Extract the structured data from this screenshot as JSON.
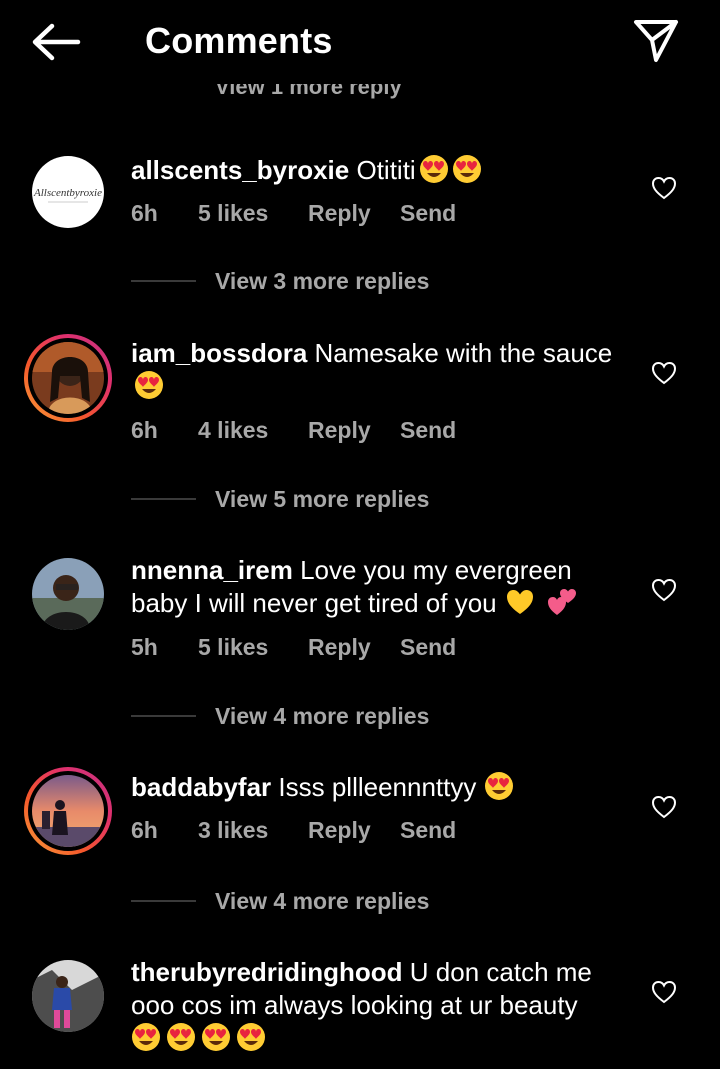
{
  "header": {
    "title": "Comments"
  },
  "partial_view_replies": "View 1 more reply",
  "comments": [
    {
      "username": "allscents_byroxie",
      "text": "Otititi",
      "emoji": [
        "heart-eyes",
        "heart-eyes"
      ],
      "time": "6h",
      "likes": "5 likes",
      "reply": "Reply",
      "send": "Send",
      "view_replies": "View 3 more replies",
      "avatar_logo_text": "Allscentbyroxie"
    },
    {
      "username": "iam_bossdora",
      "text": "Namesake with the sauce",
      "emoji": [
        "heart-eyes"
      ],
      "time": "6h",
      "likes": "4 likes",
      "reply": "Reply",
      "send": "Send",
      "view_replies": "View 5 more replies"
    },
    {
      "username": "nnenna_irem",
      "text": "Love you my evergreen baby  I will never get tired of you",
      "emoji": [
        "yellow-heart",
        "two-hearts"
      ],
      "time": "5h",
      "likes": "5 likes",
      "reply": "Reply",
      "send": "Send",
      "view_replies": "View 4 more replies"
    },
    {
      "username": "baddabyfar",
      "text": "Isss pllleennnttyy",
      "emoji": [
        "heart-eyes"
      ],
      "time": "6h",
      "likes": "3 likes",
      "reply": "Reply",
      "send": "Send",
      "view_replies": "View 4 more replies"
    },
    {
      "username": "therubyredridinghood",
      "text": "U don catch me ooo cos im always looking at ur beauty",
      "emoji": [
        "heart-eyes",
        "heart-eyes",
        "heart-eyes",
        "heart-eyes"
      ]
    }
  ]
}
